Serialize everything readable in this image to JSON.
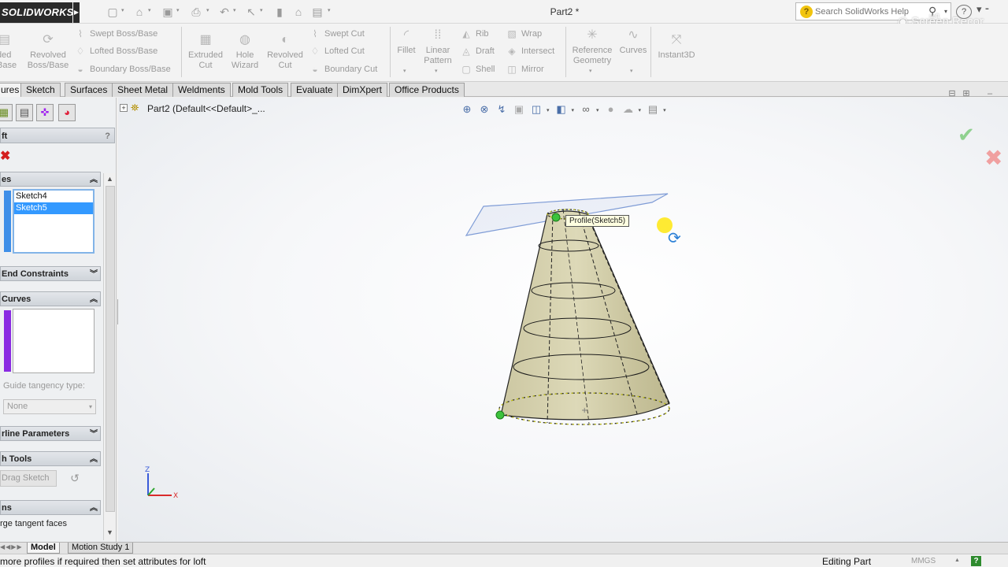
{
  "titlebar": {
    "logo": "SOLIDWORKS",
    "document_title": "Part2 *",
    "help_search": {
      "placeholder": "Search SolidWorks Help"
    },
    "help_button": "?",
    "watermark_line1": "Screen Recor",
    "watermark_line2": "soft"
  },
  "ribbon": {
    "large_buttons": [
      {
        "id": "extruded-boss",
        "label": "ded\nBase",
        "icon": "extrude-icon"
      },
      {
        "id": "revolved-boss",
        "label": "Revolved\nBoss/Base",
        "icon": "revolve-icon"
      },
      {
        "id": "extruded-cut",
        "label": "Extruded\nCut",
        "icon": "extruded-cut-icon"
      },
      {
        "id": "hole-wizard",
        "label": "Hole\nWizard",
        "icon": "hole-wizard-icon"
      },
      {
        "id": "revolved-cut",
        "label": "Revolved\nCut",
        "icon": "revolved-cut-icon"
      },
      {
        "id": "fillet",
        "label": "Fillet",
        "icon": "fillet-icon"
      },
      {
        "id": "linear-pattern",
        "label": "Linear\nPattern",
        "icon": "linear-pattern-icon"
      },
      {
        "id": "reference-geometry",
        "label": "Reference\nGeometry",
        "icon": "reference-geometry-icon"
      },
      {
        "id": "curves",
        "label": "Curves",
        "icon": "curves-icon"
      },
      {
        "id": "instant3d",
        "label": "Instant3D",
        "icon": "instant3d-icon"
      }
    ],
    "small_buttons": [
      {
        "id": "swept-boss",
        "label": "Swept Boss/Base"
      },
      {
        "id": "lofted-boss",
        "label": "Lofted Boss/Base"
      },
      {
        "id": "boundary-boss",
        "label": "Boundary Boss/Base"
      },
      {
        "id": "swept-cut",
        "label": "Swept Cut"
      },
      {
        "id": "lofted-cut",
        "label": "Lofted Cut"
      },
      {
        "id": "boundary-cut",
        "label": "Boundary Cut"
      },
      {
        "id": "rib",
        "label": "Rib"
      },
      {
        "id": "draft",
        "label": "Draft"
      },
      {
        "id": "shell",
        "label": "Shell"
      },
      {
        "id": "wrap",
        "label": "Wrap"
      },
      {
        "id": "intersect",
        "label": "Intersect"
      },
      {
        "id": "mirror",
        "label": "Mirror"
      }
    ]
  },
  "command_tabs": [
    "ures",
    "Sketch",
    "Surfaces",
    "Sheet Metal",
    "Weldments",
    "Mold Tools",
    "Evaluate",
    "DimXpert",
    "Office Products"
  ],
  "property_manager": {
    "title": "ft",
    "help": "?",
    "profiles_header": "es",
    "profiles": [
      "Sketch4",
      "Sketch5"
    ],
    "selected_profile": "Sketch5",
    "end_constraints_header": "End Constraints",
    "guide_curves_header": "Curves",
    "guide_tangency_label": "Guide tangency type:",
    "guide_tangency_value": "None",
    "centerline_header": "rline Parameters",
    "sketch_tools_header": "h Tools",
    "drag_sketch": "Drag Sketch",
    "options_header": "ns",
    "merge_tangent": "rge tangent faces",
    "profile_color": "#3f8fe8",
    "guide_color": "#8a2be2"
  },
  "graphics": {
    "tree_label": "Part2  (Default<<Default>_...",
    "tooltip": "Profile(Sketch5)",
    "triad": {
      "z": "Z",
      "x": "X"
    }
  },
  "bottom_tabs": [
    "Model",
    "Motion Study 1"
  ],
  "status": {
    "message": "more profiles if required then set attributes for loft",
    "mode": "Editing Part",
    "units": "MMGS",
    "help": "?"
  }
}
